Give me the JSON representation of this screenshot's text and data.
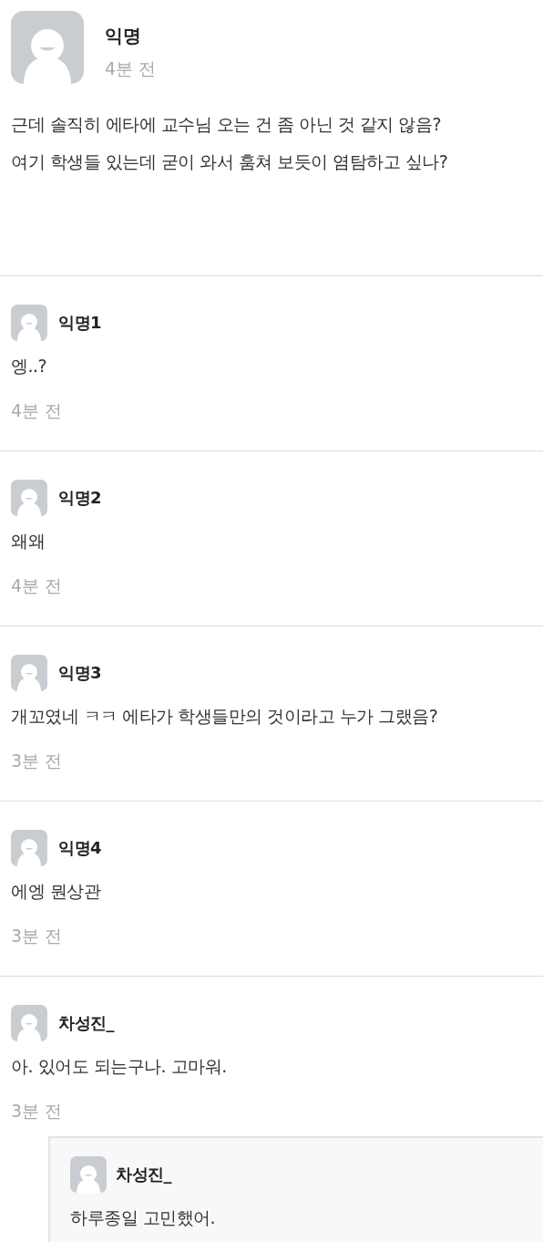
{
  "post": {
    "author": "익명",
    "time": "4분 전",
    "body": [
      "근데 솔직히 에타에 교수님 오는 건 좀 아닌 것 같지 않음?",
      "여기 학생들 있는데 굳이 와서 훔쳐 보듯이 염탐하고 싶나?"
    ]
  },
  "comments": [
    {
      "author": "익명1",
      "text": "엥..?",
      "time": "4분 전"
    },
    {
      "author": "익명2",
      "text": "왜왜",
      "time": "4분 전"
    },
    {
      "author": "익명3",
      "text": "개꼬였네 ㅋㅋ 에타가 학생들만의 것이라고 누가 그랬음?",
      "time": "3분 전"
    },
    {
      "author": "익명4",
      "text": "에엥 뭔상관",
      "time": "3분 전"
    },
    {
      "author": "차성진_",
      "text": "아. 있어도 되는구나. 고마워.",
      "time": "3분 전",
      "replies": [
        {
          "author": "차성진_",
          "text": "하루종일 고민했어."
        }
      ]
    }
  ]
}
